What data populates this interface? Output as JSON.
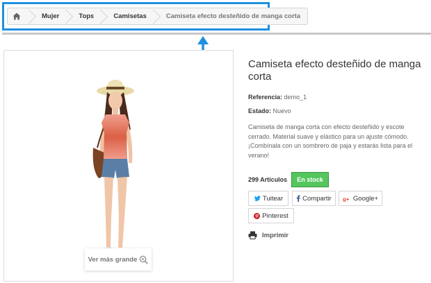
{
  "breadcrumb": {
    "home_icon": "home-icon",
    "items": [
      "Mujer",
      "Tops",
      "Camisetas",
      "Camiseta efecto desteñido de manga corta"
    ]
  },
  "product": {
    "title": "Camiseta efecto desteñido de manga corta",
    "reference_label": "Referencia:",
    "reference_value": "demo_1",
    "condition_label": "Estado:",
    "condition_value": "Nuevo",
    "description": "Camiseta de manga corta con efecto desteñido y escote cerrado. Material suave y elástico para un ajuste cómodo. ¡Combínala con un sombrero de paja y estarás lista para el verano!",
    "quantity": "299 Artículos",
    "stock_badge": "En stock",
    "zoom_label": "Ver más grande"
  },
  "share": {
    "twitter": "Tuitear",
    "facebook": "Compartir",
    "google": "Google+",
    "pinterest": "Pinterest"
  },
  "print_label": "Imprimir",
  "colors": {
    "highlight": "#1d8fe0",
    "stock": "#55c65e",
    "twitter": "#1da1f2",
    "facebook": "#3b5998",
    "google": "#dd4b39",
    "pinterest": "#cb2027"
  }
}
